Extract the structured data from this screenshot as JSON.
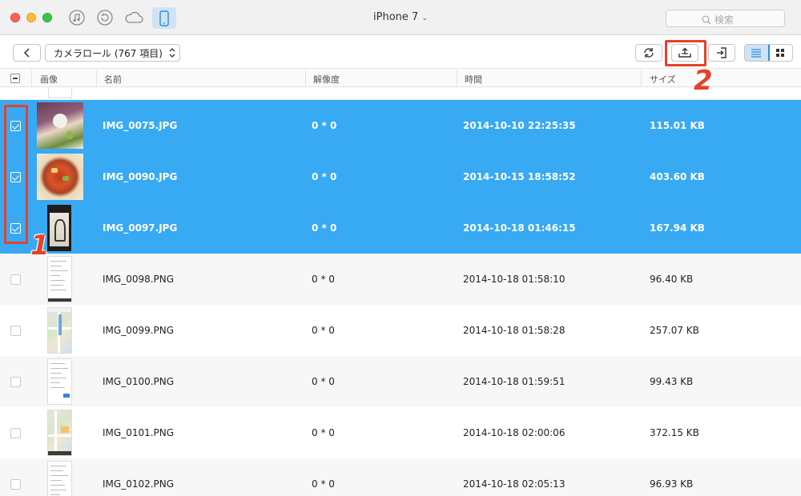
{
  "window": {
    "device_title": "iPhone 7",
    "search_placeholder": "検索",
    "nav_icons": [
      "music-icon",
      "restore-icon",
      "cloud-icon",
      "phone-icon"
    ]
  },
  "toolbar": {
    "album_label": "カメラロール (767 項目)",
    "buttons": [
      "back-icon",
      "refresh-icon",
      "export-to-computer-icon",
      "import-to-device-icon",
      "list-view-icon",
      "grid-view-icon"
    ]
  },
  "annotations": {
    "one": "1",
    "two": "2"
  },
  "table": {
    "columns": [
      "画像",
      "名前",
      "解像度",
      "時間",
      "サイズ"
    ],
    "rows": [
      {
        "name": "IMG_0075.JPG",
        "resolution": "0 * 0",
        "time": "2014-10-10 22:25:35",
        "size": "115.01 KB",
        "selected": true
      },
      {
        "name": "IMG_0090.JPG",
        "resolution": "0 * 0",
        "time": "2014-10-15 18:58:52",
        "size": "403.60 KB",
        "selected": true
      },
      {
        "name": "IMG_0097.JPG",
        "resolution": "0 * 0",
        "time": "2014-10-18 01:46:15",
        "size": "167.94 KB",
        "selected": true
      },
      {
        "name": "IMG_0098.PNG",
        "resolution": "0 * 0",
        "time": "2014-10-18 01:58:10",
        "size": "96.40 KB",
        "selected": false
      },
      {
        "name": "IMG_0099.PNG",
        "resolution": "0 * 0",
        "time": "2014-10-18 01:58:28",
        "size": "257.07 KB",
        "selected": false
      },
      {
        "name": "IMG_0100.PNG",
        "resolution": "0 * 0",
        "time": "2014-10-18 01:59:51",
        "size": "99.43 KB",
        "selected": false
      },
      {
        "name": "IMG_0101.PNG",
        "resolution": "0 * 0",
        "time": "2014-10-18 02:00:06",
        "size": "372.15 KB",
        "selected": false
      },
      {
        "name": "IMG_0102.PNG",
        "resolution": "0 * 0",
        "time": "2014-10-18 02:05:13",
        "size": "96.93 KB",
        "selected": false
      }
    ]
  },
  "colors": {
    "selection": "#38a9f3",
    "annotation": "#e8412a",
    "accent": "#2d8be0"
  }
}
